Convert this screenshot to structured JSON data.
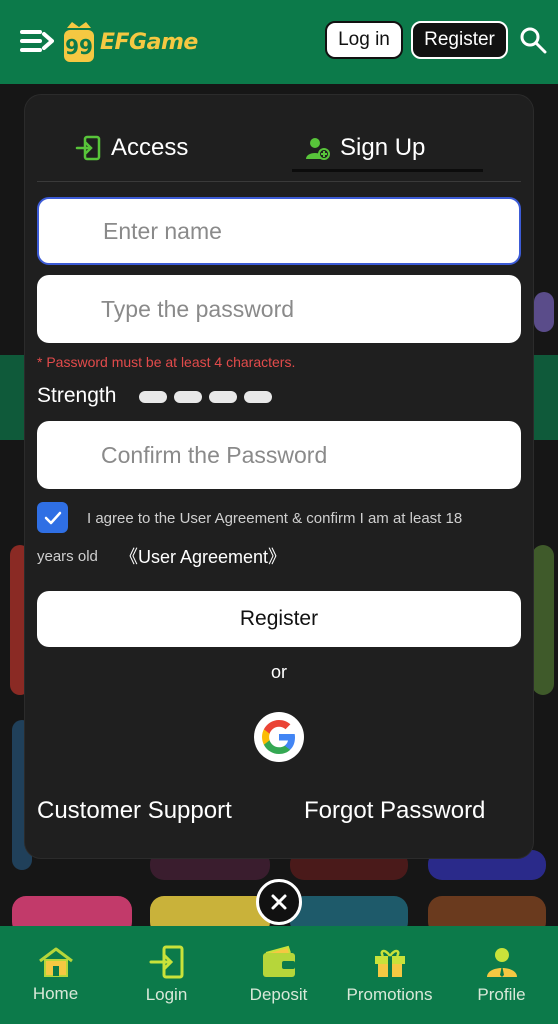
{
  "header": {
    "brand_badge": "99",
    "brand": "EFGame",
    "login_label": "Log in",
    "register_label": "Register"
  },
  "modal": {
    "tabs": [
      {
        "label": "Access"
      },
      {
        "label": "Sign Up",
        "active": true
      }
    ],
    "name_placeholder": "Enter name",
    "password_placeholder": "Type the password",
    "password_hint": "* Password must be at least 4 characters.",
    "strength_label": "Strength",
    "confirm_placeholder": "Confirm the Password",
    "agreement_checked": true,
    "agreement_line1": "I agree to the User Agreement & confirm I am at least 18",
    "agreement_line2": "years old",
    "agreement_link": "《User Agreement》",
    "register_button": "Register",
    "or_text": "or",
    "customer_support": "Customer Support",
    "forgot_password": "Forgot Password"
  },
  "bottom_nav": [
    {
      "label": "Home",
      "icon": "home-icon"
    },
    {
      "label": "Login",
      "icon": "login-icon"
    },
    {
      "label": "Deposit",
      "icon": "wallet-icon"
    },
    {
      "label": "Promotions",
      "icon": "gift-icon"
    },
    {
      "label": "Profile",
      "icon": "profile-icon"
    }
  ],
  "colors": {
    "brand_green": "#0c7a4a",
    "accent_gold": "#f5c842",
    "checkbox_blue": "#2f6fe4",
    "error_red": "#e24b4b"
  }
}
